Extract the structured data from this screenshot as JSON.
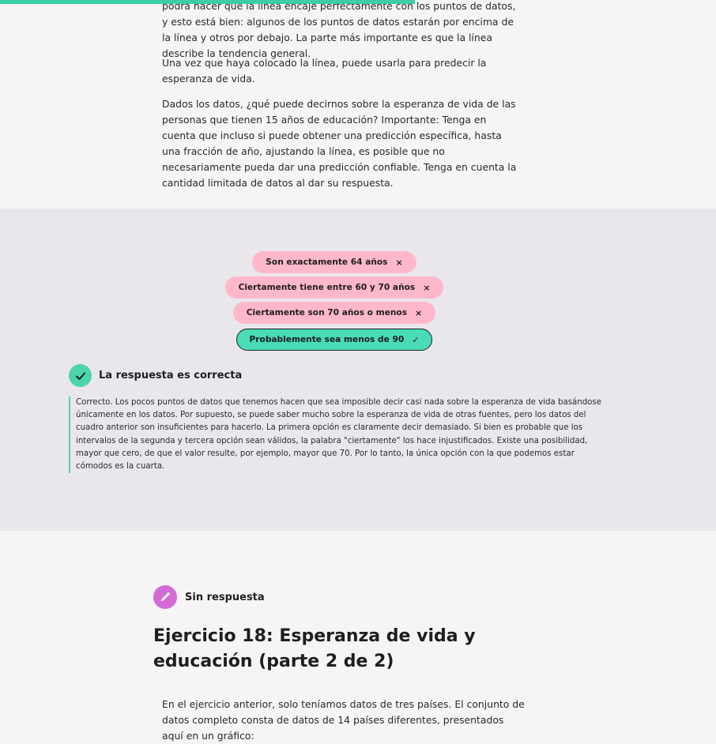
{
  "progress": {
    "fraction": 0.58,
    "color": "#3ccfa3"
  },
  "intro_text": {
    "p1": "podrá hacer que la línea encaje perfectamente con los puntos de datos, y esto está bien: algunos de los puntos de datos estarán por encima de la línea y otros por debajo. La parte más importante es que la línea describe la tendencia general.",
    "p2": "Una vez que haya colocado la línea, puede usarla para predecir la esperanza de vida.",
    "p3": "Dados los datos, ¿qué puede decirnos sobre la esperanza de vida de las personas que tienen 15 años de educación? Importante: Tenga en cuenta que incluso si puede obtener una predicción específica, hasta una fracción de año, ajustando la línea, es posible que no necesariamente pueda dar una predicción confiable. Tenga en cuenta la cantidad limitada de datos al dar su respuesta."
  },
  "quiz": {
    "options": [
      {
        "label": "Son exactamente 64 años",
        "mark": "×",
        "state": "incorrect"
      },
      {
        "label": "Ciertamente tiene entre 60 y 70 años",
        "mark": "×",
        "state": "incorrect"
      },
      {
        "label": "Ciertamente son 70 años o menos",
        "mark": "×",
        "state": "incorrect"
      },
      {
        "label": "Probablemente sea menos de 90",
        "mark": "✓",
        "state": "correct"
      }
    ],
    "result_title": "La respuesta es correcta",
    "feedback": "Correcto. Los pocos puntos de datos que tenemos hacen que sea imposible decir casi nada sobre la esperanza de vida basándose únicamente en los datos. Por supuesto, se puede saber mucho sobre la esperanza de vida de otras fuentes, pero los datos del cuadro anterior son insuficientes para hacerlo. La primera opción es claramente decir demasiado. Si bien es probable que los intervalos de la segunda y tercera opción sean válidos, la palabra \"ciertamente\" los hace injustificados. Existe una posibilidad, mayor que cero, de que el valor resulte, por ejemplo, mayor que 70. Por lo tanto, la única opción con la que podemos estar cómodos es la cuarta."
  },
  "next_exercise": {
    "status": "Sin respuesta",
    "title": "Ejercicio 18: Esperanza de vida y educación (parte 2 de 2)",
    "intro": "En el ejercicio anterior, solo teníamos datos de tres países. El conjunto de datos completo consta de datos de 14 países diferentes, presentados aquí en un gráfico:"
  },
  "colors": {
    "incorrect_bg": "#ffb8cb",
    "correct_bg": "#49dcb6",
    "check_green": "#4cd4ae",
    "pencil_purple": "#d46ad6",
    "quiz_bg": "#e9e7ec",
    "page_bg": "#f6f4f5"
  },
  "icons": [
    "check-icon",
    "pencil-icon",
    "close-icon"
  ]
}
